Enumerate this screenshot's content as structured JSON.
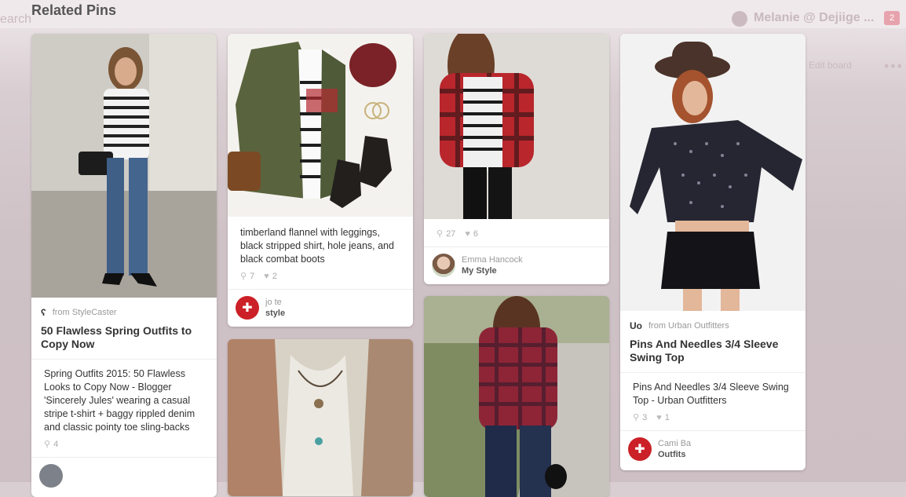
{
  "section_title": "Related Pins",
  "background": {
    "left_text": "earch",
    "user_name": "Melanie @ Dejiige ...",
    "edit_board": "Edit board",
    "badge_count": "2"
  },
  "pins": [
    {
      "source_label": "from StyleCaster",
      "title": "50 Flawless Spring Outfits to Copy Now",
      "description": "Spring Outfits 2015: 50 Flawless Looks to Copy Now - Blogger 'Sincerely Jules' wearing a casual stripe t-shirt + baggy rippled denim and classic pointy toe sling-backs",
      "repins": "4"
    },
    {
      "description": "timberland flannel with leggings, black stripped shirt, hole jeans, and black combat boots",
      "repins": "7",
      "likes": "2",
      "user": "jo te",
      "board": "style"
    },
    {
      "repins": "27",
      "likes": "6",
      "user": "Emma Hancock",
      "board": "My Style"
    },
    {
      "source_label": "from Urban Outfitters",
      "title": "Pins And Needles 3/4 Sleeve Swing Top",
      "description": "Pins And Needles 3/4 Sleeve Swing Top - Urban Outfitters",
      "repins": "3",
      "likes": "1",
      "user": "Cami Ba",
      "board": "Outfits"
    }
  ],
  "icons": {
    "repin": "pushpin-repin-icon",
    "like": "heart-icon",
    "pinterest": "pinterest-icon"
  },
  "colors": {
    "pinterest_red": "#cb2027",
    "card_bg": "#ffffff",
    "muted_text": "#999999"
  }
}
